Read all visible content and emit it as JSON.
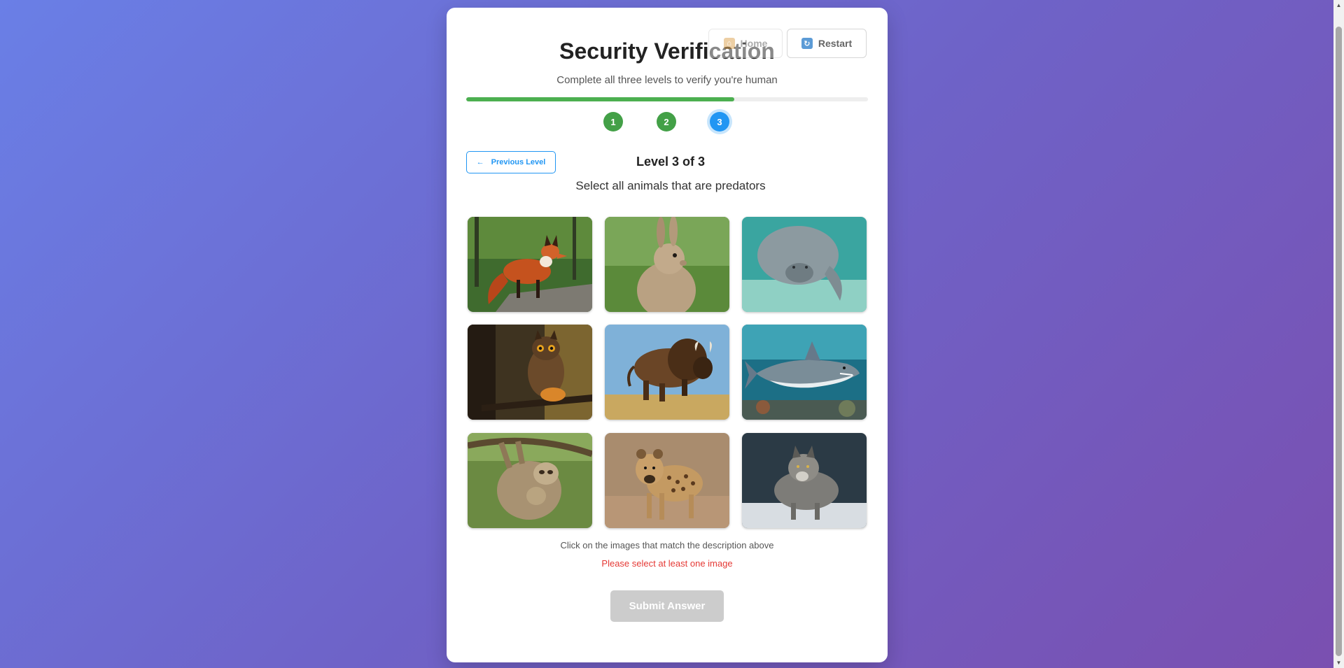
{
  "header": {
    "title": "Security Verification",
    "subtitle": "Complete all three levels to verify you're human",
    "home_label": "Home",
    "home_icon": "home-icon",
    "restart_label": "Restart",
    "restart_icon": "restart-icon"
  },
  "progress": {
    "fraction": 0.667,
    "fill_color": "#4caf50",
    "steps": [
      {
        "label": "1",
        "state": "done"
      },
      {
        "label": "2",
        "state": "done"
      },
      {
        "label": "3",
        "state": "active"
      }
    ]
  },
  "level": {
    "prev_label": "Previous Level",
    "prev_icon": "arrow-left-icon",
    "title": "Level 3 of 3",
    "instruction": "Select all animals that are predators"
  },
  "images": [
    {
      "name": "fox"
    },
    {
      "name": "rabbit"
    },
    {
      "name": "manatee"
    },
    {
      "name": "owl"
    },
    {
      "name": "bison"
    },
    {
      "name": "shark"
    },
    {
      "name": "sloth"
    },
    {
      "name": "hyena"
    },
    {
      "name": "wolf"
    }
  ],
  "footer": {
    "hint": "Click on the images that match the description above",
    "error": "Please select at least one image",
    "submit_label": "Submit Answer"
  },
  "colors": {
    "accent": "#2196f3",
    "success": "#43a047",
    "error": "#e53935",
    "disabled": "#cccccc"
  }
}
